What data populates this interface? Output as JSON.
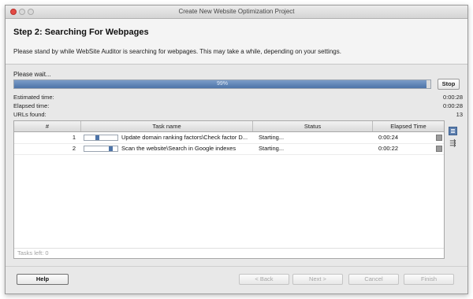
{
  "window": {
    "title": "Create New Website Optimization Project"
  },
  "header": {
    "step_title": "Step 2: Searching For Webpages",
    "description": "Please stand by while WebSite Auditor is searching for webpages. This may take a while, depending on your settings."
  },
  "progress": {
    "wait_label": "Please wait...",
    "percent": 99,
    "percent_label": "99%",
    "stop_label": "Stop"
  },
  "info": {
    "estimated_label": "Estimated time:",
    "estimated_value": "0:00:28",
    "elapsed_label": "Elapsed time:",
    "elapsed_value": "0:00:28",
    "urls_label": "URLs found:",
    "urls_value": "13"
  },
  "table": {
    "columns": [
      "#",
      "Task name",
      "Status",
      "Elapsed Time"
    ],
    "rows": [
      {
        "num": "1",
        "progress": 0.45,
        "task": "Update domain ranking factors\\Check factor D...",
        "status": "Starting...",
        "elapsed": "0:00:24"
      },
      {
        "num": "2",
        "progress": 0.85,
        "task": "Scan the website\\Search in Google indexes",
        "status": "Starting...",
        "elapsed": "0:00:22"
      }
    ],
    "tasks_left": "Tasks left: 0"
  },
  "footer": {
    "help": "Help",
    "back": "< Back",
    "next": "Next >",
    "cancel": "Cancel",
    "finish": "Finish"
  },
  "colors": {
    "accent": "#4d74a8",
    "close": "#e34b45"
  },
  "icons": {
    "table_view": "table-view-icon",
    "columns": "columns-settings-icon",
    "row_action": "row-options-icon"
  }
}
